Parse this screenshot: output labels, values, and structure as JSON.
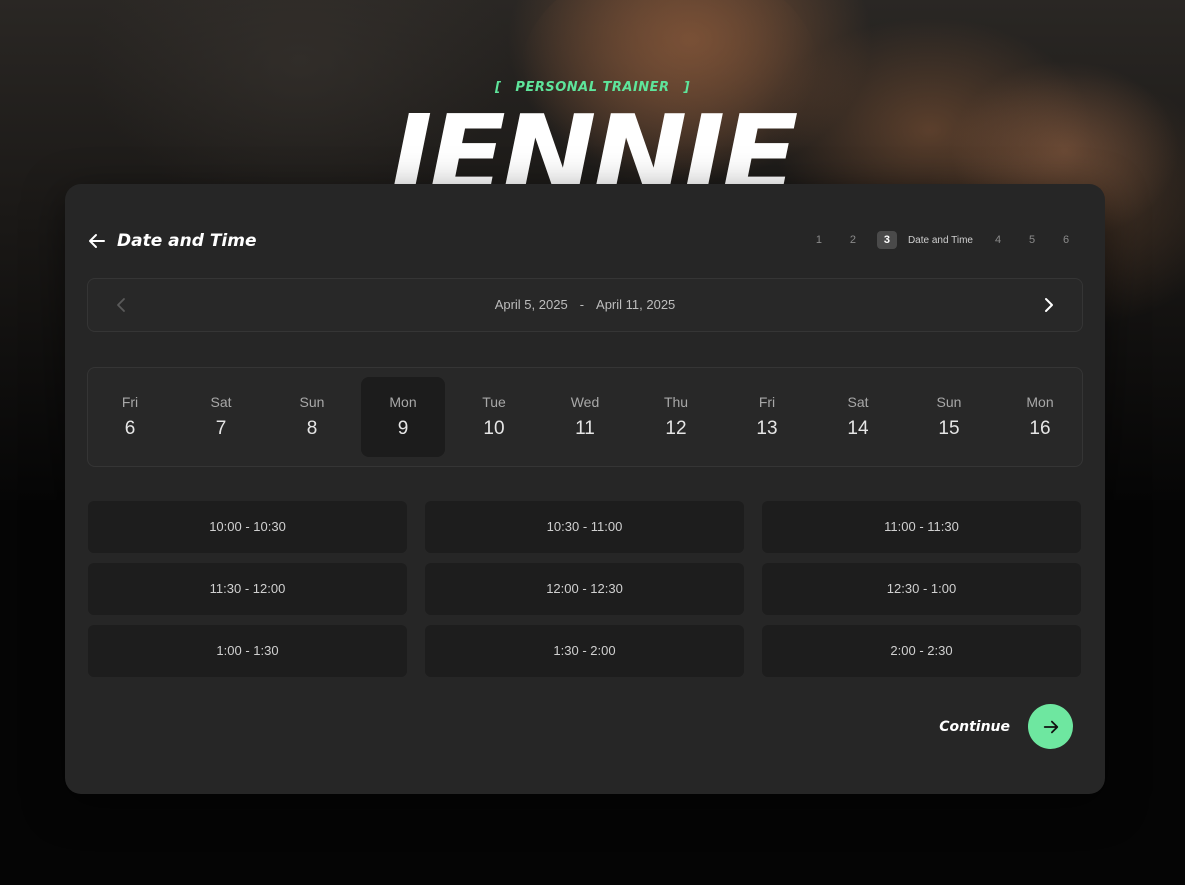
{
  "hero": {
    "subtitle": "PERSONAL TRAINER",
    "bracket_left": "[",
    "bracket_right": "]",
    "name": "JENNIE"
  },
  "header": {
    "title": "Date and Time",
    "steps": [
      "1",
      "2",
      "3",
      "4",
      "5",
      "6"
    ],
    "active_step": "3",
    "active_step_label": "Date and Time"
  },
  "range": {
    "start": "April 5, 2025",
    "separator": "-",
    "end": "April 11, 2025"
  },
  "days": [
    {
      "name": "Fri",
      "num": "6"
    },
    {
      "name": "Sat",
      "num": "7"
    },
    {
      "name": "Sun",
      "num": "8"
    },
    {
      "name": "Mon",
      "num": "9",
      "selected": true
    },
    {
      "name": "Tue",
      "num": "10"
    },
    {
      "name": "Wed",
      "num": "11"
    },
    {
      "name": "Thu",
      "num": "12"
    },
    {
      "name": "Fri",
      "num": "13"
    },
    {
      "name": "Sat",
      "num": "14"
    },
    {
      "name": "Sun",
      "num": "15"
    },
    {
      "name": "Mon",
      "num": "16"
    }
  ],
  "slots": [
    "10:00 - 10:30",
    "10:30 - 11:00",
    "11:00 - 11:30",
    "11:30 - 12:00",
    "12:00 - 12:30",
    "12:30 - 1:00",
    "1:00 - 1:30",
    "1:30 - 2:00",
    "2:00 - 2:30"
  ],
  "footer": {
    "continue_label": "Continue"
  },
  "colors": {
    "accent": "#6ee7a0",
    "subtitle": "#5ee59b",
    "card": "#262626",
    "slot": "#1d1d1d"
  },
  "icons": {
    "back": "arrow-left-icon",
    "prev": "chevron-left-icon",
    "next": "chevron-right-icon",
    "continue": "arrow-right-icon"
  }
}
